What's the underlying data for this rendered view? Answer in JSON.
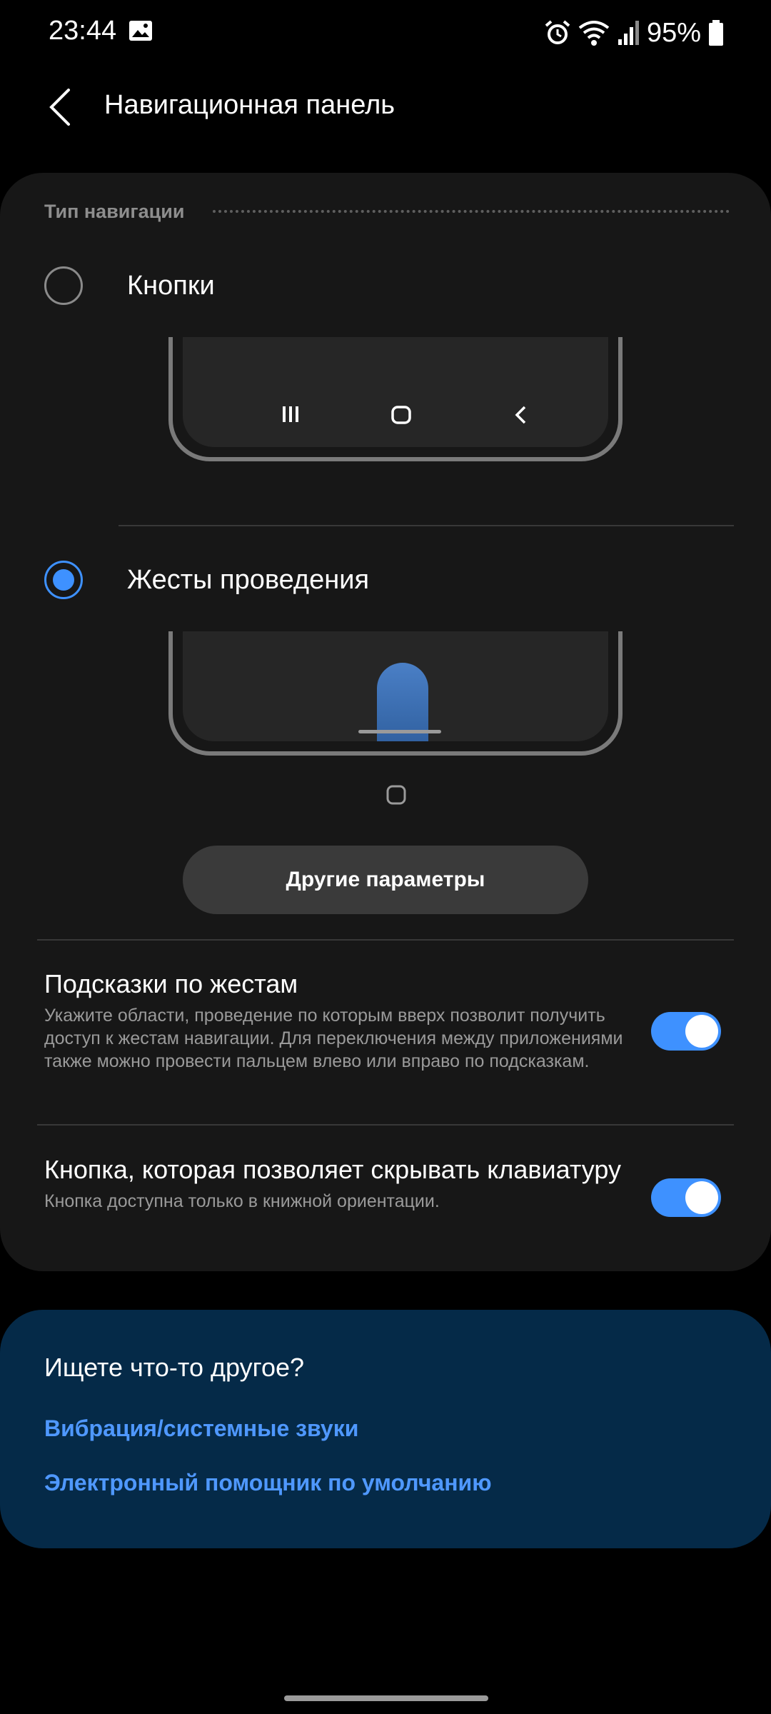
{
  "status_bar": {
    "time": "23:44",
    "battery_percent": "95%",
    "icons": [
      "gallery-icon",
      "alarm-icon",
      "wifi-icon",
      "signal-icon",
      "battery-icon"
    ]
  },
  "header": {
    "back_icon": "back-chevron-icon",
    "title": "Навигационная панель"
  },
  "navigation_type": {
    "section_title": "Тип навигации",
    "options": [
      {
        "label": "Кнопки",
        "selected": false
      },
      {
        "label": "Жесты проведения",
        "selected": true
      }
    ],
    "more_button": "Другие параметры"
  },
  "settings": [
    {
      "title": "Подсказки по жестам",
      "description": "Укажите области, проведение по которым вверх позволит получить доступ к жестам навигации. Для переключения между приложениями также можно провести пальцем влево или вправо по подсказкам.",
      "enabled": true
    },
    {
      "title": "Кнопка, которая позволяет скрывать клавиатуру",
      "description": "Кнопка доступна только в книжной ориентации.",
      "enabled": true
    }
  ],
  "search_suggestions": {
    "title": "Ищете что-то другое?",
    "links": [
      "Вибрация/системные звуки",
      "Электронный помощник по умолчанию"
    ]
  },
  "colors": {
    "accent": "#3e91ff",
    "card_bg": "#171717",
    "search_card_bg": "#052a48",
    "link": "#4f98ff"
  }
}
